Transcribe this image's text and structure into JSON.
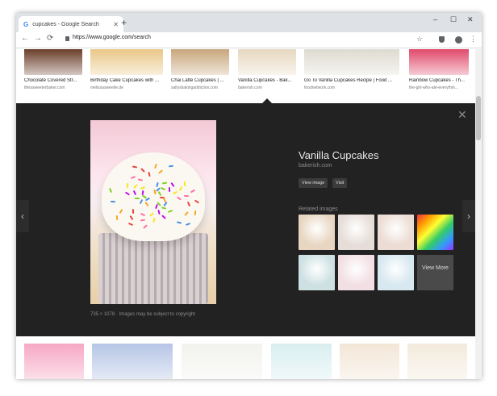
{
  "browser": {
    "tab_title": "cupcakes - Google Search",
    "tab_icon": "G",
    "new_tab_symbol": "+",
    "url": "https://www.google.com/search",
    "window_controls": [
      "–",
      "☐",
      "✕"
    ],
    "nav": {
      "back": "←",
      "forward": "→",
      "reload": "⟳"
    },
    "bookmark": "☆",
    "menu": "⋮"
  },
  "results_top": [
    {
      "caption": "Chocolate Covered Str...",
      "source": "lifeissweeterbaker.com",
      "color": "#6b3e2a"
    },
    {
      "caption": "Birthday Cake Cupcakes with ...",
      "source": "melissasweetie.de",
      "color": "#e9c787"
    },
    {
      "caption": "Chai Latte Cupcakes | ...",
      "source": "sallysbakingaddiction.com",
      "color": "#c8a67c"
    },
    {
      "caption": "Vanilla Cupcakes - Bak...",
      "source": "bakerish.com",
      "color": "#e7d8c0"
    },
    {
      "caption": "Go To Vanilla Cupcakes Recipe | Food ...",
      "source": "foodnetwork.com",
      "color": "#dedad0"
    },
    {
      "caption": "Rainbow Cupcakes - Th...",
      "source": "the-girl-who-ate-everythin...",
      "color": "#e04a6b"
    }
  ],
  "preview": {
    "title": "Vanilla Cupcakes",
    "source": "bakerish.com",
    "view_image": "View image",
    "visit": "Visit",
    "caption": "735 × 1078 · Images may be subject to copyright",
    "related_label": "Related images",
    "view_more": "View More",
    "close": "✕",
    "prev": "‹",
    "next": "›",
    "related_colors": [
      "#e8d6c2",
      "#e6ddd8",
      "#ecdcd4",
      "#cde0e2",
      "#f2dfe4",
      "#d7e8f0",
      "#bfe1df"
    ]
  },
  "results_bottom": [
    {
      "color": "#f6a8c4"
    },
    {
      "color": "#b7c6e6"
    },
    {
      "color": "#f2f2ee"
    },
    {
      "color": "#d9eef0"
    },
    {
      "color": "#f3e6d7"
    },
    {
      "color": "#f3eadc"
    }
  ]
}
